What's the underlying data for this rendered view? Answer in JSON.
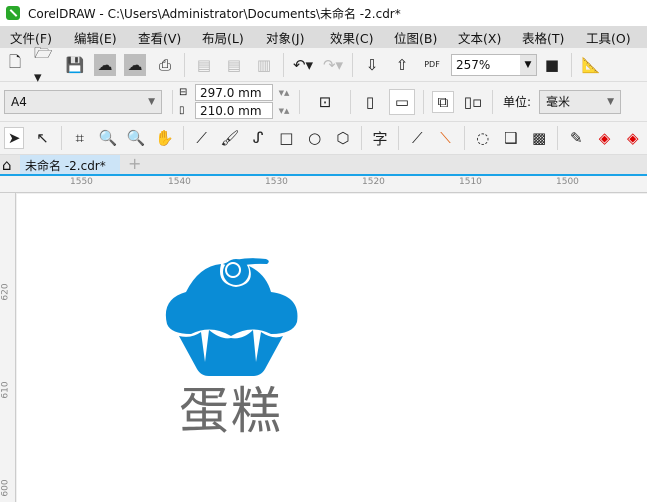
{
  "title": "CorelDRAW - C:\\Users\\Administrator\\Documents\\未命名 -2.cdr*",
  "menu": [
    "文件(F)",
    "编辑(E)",
    "查看(V)",
    "布局(L)",
    "对象(J)",
    "效果(C)",
    "位图(B)",
    "文本(X)",
    "表格(T)",
    "工具(O)"
  ],
  "toolbar": {
    "zoom": "257%",
    "pdf": "PDF"
  },
  "property": {
    "page_size": "A4",
    "height": "297.0 mm",
    "width": "210.0 mm",
    "unit_label": "单位:",
    "unit": "毫米"
  },
  "tab": {
    "label": "未命名 -2.cdr*",
    "add": "+"
  },
  "ruler": {
    "top": [
      "1550",
      "1540",
      "1530",
      "1520",
      "1510",
      "1500"
    ],
    "left": [
      "620",
      "610",
      "600"
    ]
  },
  "artwork": {
    "text": "蛋糕",
    "icon_color": "#0a8cd6",
    "text_color": "#6b6b6b"
  }
}
